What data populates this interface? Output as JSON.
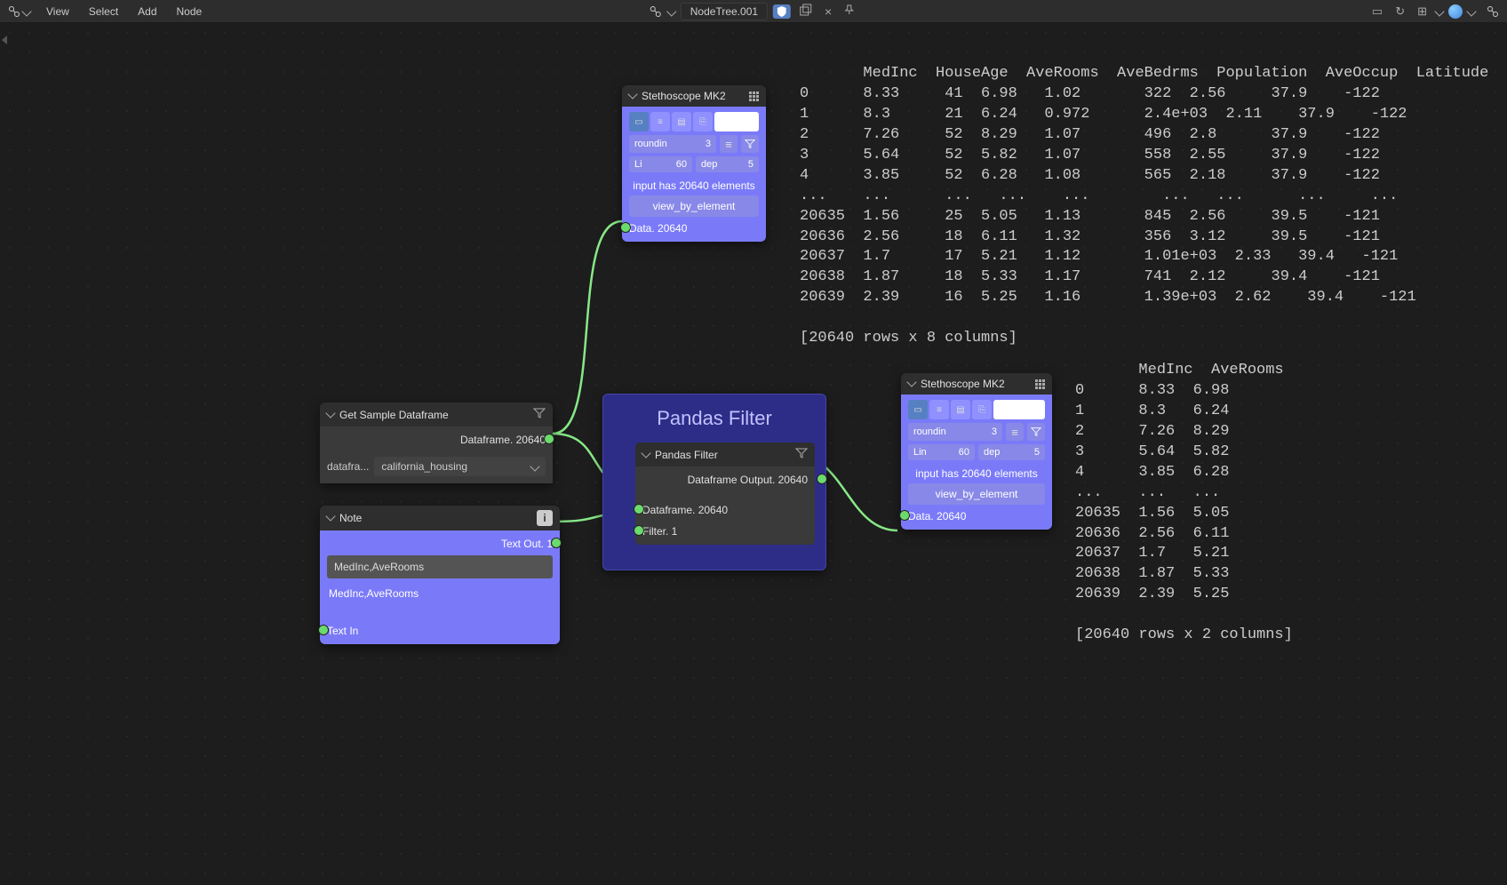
{
  "topbar": {
    "menu": [
      "View",
      "Select",
      "Add",
      "Node"
    ],
    "nodetree": "NodeTree.001"
  },
  "nodes": {
    "getsample": {
      "title": "Get Sample Dataframe",
      "out_label": "Dataframe. 20640",
      "field_label": "datafra...",
      "dropdown": "california_housing"
    },
    "note": {
      "title": "Note",
      "out_label": "Text Out. 1",
      "input_value": "MedInc,AveRooms",
      "display": "MedInc,AveRooms",
      "in_label": "Text In"
    },
    "filter": {
      "big_title": "Pandas Filter",
      "title": "Pandas Filter",
      "out_label": "Dataframe Output. 20640",
      "in1": "Dataframe. 20640",
      "in2": "Filter. 1"
    },
    "steth1": {
      "title": "Stethoscope MK2",
      "roundin": "roundin",
      "roundin_v": "3",
      "li": "Li",
      "li_v": "60",
      "dep": "dep",
      "dep_v": "5",
      "info": "input has 20640 elements",
      "view": "view_by_element",
      "data": "Data. 20640"
    },
    "steth2": {
      "title": "Stethoscope MK2",
      "roundin": "roundin",
      "roundin_v": "3",
      "li": "Lin",
      "li_v": "60",
      "dep": "dep",
      "dep_v": "5",
      "info": "input has 20640 elements",
      "view": "view_by_element",
      "data": "Data. 20640"
    }
  },
  "overlay1": "       MedInc  HouseAge  AveRooms  AveBedrms  Population  AveOccup  Latitude  Longitude\n0      8.33     41  6.98   1.02       322  2.56     37.9    -122\n1      8.3      21  6.24   0.972      2.4e+03  2.11    37.9    -122\n2      7.26     52  8.29   1.07       496  2.8      37.9    -122\n3      5.64     52  5.82   1.07       558  2.55     37.9    -122\n4      3.85     52  6.28   1.08       565  2.18     37.9    -122\n...    ...      ...   ...    ...        ...   ...      ...     ...\n20635  1.56     25  5.05   1.13       845  2.56     39.5    -121\n20636  2.56     18  6.11   1.32       356  3.12     39.5    -121\n20637  1.7      17  5.21   1.12       1.01e+03  2.33   39.4   -121\n20638  1.87     18  5.33   1.17       741  2.12     39.4    -121\n20639  2.39     16  5.25   1.16       1.39e+03  2.62    39.4    -121\n\n[20640 rows x 8 columns]",
  "overlay2": "       MedInc  AveRooms\n0      8.33  6.98\n1      8.3   6.24\n2      7.26  8.29\n3      5.64  5.82\n4      3.85  6.28\n...    ...   ...\n20635  1.56  5.05\n20636  2.56  6.11\n20637  1.7   5.21\n20638  1.87  5.33\n20639  2.39  5.25\n\n[20640 rows x 2 columns]"
}
